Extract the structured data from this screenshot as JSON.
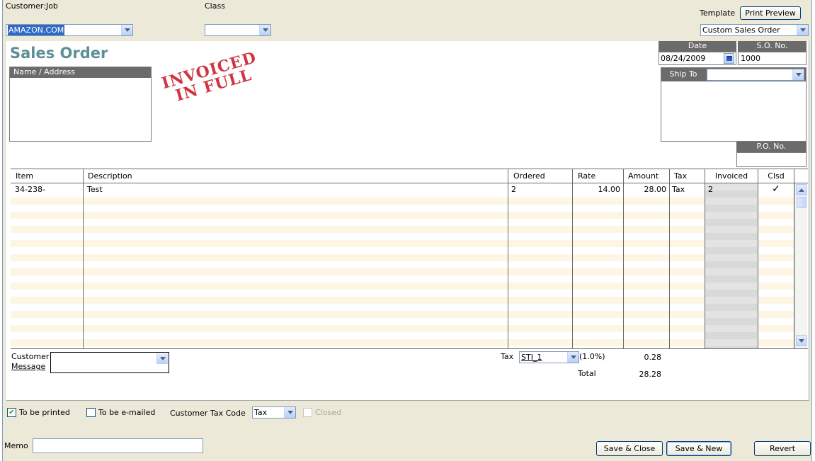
{
  "header": {
    "customer_job_label": "Customer:Job",
    "customer_job_value": "AMAZON.COM",
    "class_label": "Class",
    "class_value": "",
    "template_label": "Template",
    "print_preview_label": "Print Preview",
    "template_value": "Custom Sales Order"
  },
  "form": {
    "title": "Sales Order",
    "name_address_label": "Name / Address",
    "stamp_line1": "INVOICED",
    "stamp_line2": "IN FULL",
    "date_label": "Date",
    "date_value": "08/24/2009",
    "so_label": "S.O. No.",
    "so_value": "1000",
    "ship_to_label": "Ship To",
    "po_label": "P.O. No.",
    "po_value": ""
  },
  "grid": {
    "columns": [
      "Item",
      "Description",
      "Ordered",
      "Rate",
      "Amount",
      "Tax",
      "Invoiced",
      "Clsd"
    ],
    "rows": [
      {
        "item": "34-238-",
        "description": "Test",
        "ordered": "2",
        "rate": "14.00",
        "amount": "28.00",
        "tax": "Tax",
        "invoiced": "2",
        "clsd": "✓"
      }
    ]
  },
  "footer": {
    "customer_message_label_1": "Customer",
    "customer_message_label_2": "Message",
    "tax_label": "Tax",
    "tax_item_value": "STI_1",
    "tax_rate": "(1.0%)",
    "tax_amount": "0.28",
    "total_label": "Total",
    "total_value": "28.28"
  },
  "options": {
    "to_be_printed_label": "To be printed",
    "to_be_printed_checked": true,
    "to_be_emailed_label": "To be e-mailed",
    "to_be_emailed_checked": false,
    "customer_tax_code_label": "Customer Tax Code",
    "customer_tax_code_value": "Tax",
    "closed_label": "Closed"
  },
  "bottom": {
    "memo_label": "Memo",
    "memo_value": "",
    "save_close_label": "Save & Close",
    "save_new_label": "Save & New",
    "revert_label": "Revert"
  },
  "colors": {
    "title": "#5c8f97",
    "stamp": "#cc1f2e",
    "header_bar": "#6b6b6b",
    "row_stripe": "#fef6e4"
  }
}
